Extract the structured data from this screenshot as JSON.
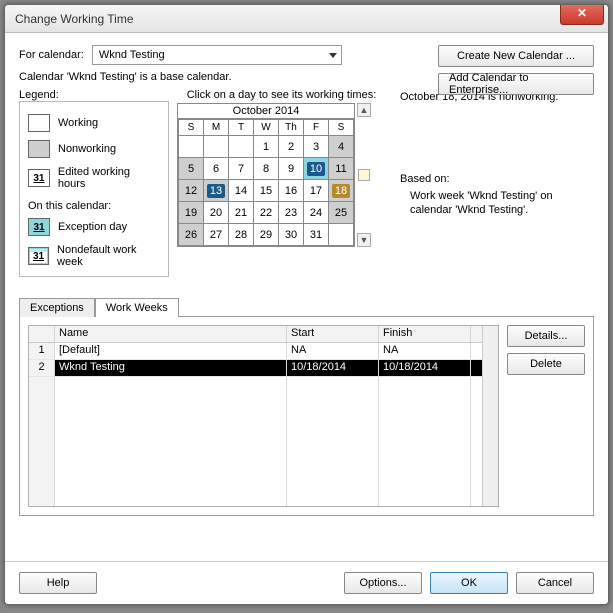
{
  "window": {
    "title": "Change Working Time"
  },
  "labels": {
    "for_calendar": "For calendar:",
    "base_calendar_msg": "Calendar 'Wknd Testing' is a base calendar.",
    "legend": "Legend:",
    "working": "Working",
    "nonworking": "Nonworking",
    "edited": "Edited working hours",
    "on_this_cal": "On this calendar:",
    "exception_day": "Exception day",
    "nondefault_ww": "Nondefault work week",
    "click_day": "Click on a day to see its working times:",
    "month": "October 2014",
    "status": "October 18, 2014 is nonworking.",
    "based_on": "Based on:",
    "based_detail": "Work week 'Wknd Testing' on calendar 'Wknd Testing'."
  },
  "dropdown": {
    "value": "Wknd Testing"
  },
  "buttons": {
    "create_new": "Create New Calendar ...",
    "add_enterprise": "Add Calendar to Enterprise...",
    "details": "Details...",
    "delete": "Delete",
    "help": "Help",
    "options": "Options...",
    "ok": "OK",
    "cancel": "Cancel"
  },
  "cal": {
    "dows": [
      "S",
      "M",
      "T",
      "W",
      "Th",
      "F",
      "S"
    ],
    "weeks": [
      [
        {
          "d": "",
          "c": ""
        },
        {
          "d": "",
          "c": ""
        },
        {
          "d": "",
          "c": ""
        },
        {
          "d": "1",
          "c": ""
        },
        {
          "d": "2",
          "c": ""
        },
        {
          "d": "3",
          "c": ""
        },
        {
          "d": "4",
          "c": "nw"
        }
      ],
      [
        {
          "d": "5",
          "c": "nw"
        },
        {
          "d": "6",
          "c": ""
        },
        {
          "d": "7",
          "c": ""
        },
        {
          "d": "8",
          "c": ""
        },
        {
          "d": "9",
          "c": ""
        },
        {
          "d": "10",
          "c": "sel"
        },
        {
          "d": "11",
          "c": "nw"
        }
      ],
      [
        {
          "d": "12",
          "c": "nw"
        },
        {
          "d": "13",
          "c": "sel dark"
        },
        {
          "d": "14",
          "c": ""
        },
        {
          "d": "15",
          "c": ""
        },
        {
          "d": "16",
          "c": ""
        },
        {
          "d": "17",
          "c": ""
        },
        {
          "d": "18",
          "c": "hl gold"
        }
      ],
      [
        {
          "d": "19",
          "c": "nw"
        },
        {
          "d": "20",
          "c": ""
        },
        {
          "d": "21",
          "c": ""
        },
        {
          "d": "22",
          "c": ""
        },
        {
          "d": "23",
          "c": ""
        },
        {
          "d": "24",
          "c": ""
        },
        {
          "d": "25",
          "c": "nw"
        }
      ],
      [
        {
          "d": "26",
          "c": "nw"
        },
        {
          "d": "27",
          "c": ""
        },
        {
          "d": "28",
          "c": ""
        },
        {
          "d": "29",
          "c": ""
        },
        {
          "d": "30",
          "c": ""
        },
        {
          "d": "31",
          "c": ""
        },
        {
          "d": "",
          "c": ""
        }
      ]
    ]
  },
  "tabs": {
    "exceptions": "Exceptions",
    "work_weeks": "Work Weeks"
  },
  "grid": {
    "headers": {
      "num": "",
      "name": "Name",
      "start": "Start",
      "finish": "Finish"
    },
    "rows": [
      {
        "num": "1",
        "name": "[Default]",
        "start": "NA",
        "finish": "NA",
        "selected": false
      },
      {
        "num": "2",
        "name": "Wknd Testing",
        "start": "10/18/2014",
        "finish": "10/18/2014",
        "selected": true
      }
    ]
  },
  "swatch31": "31"
}
